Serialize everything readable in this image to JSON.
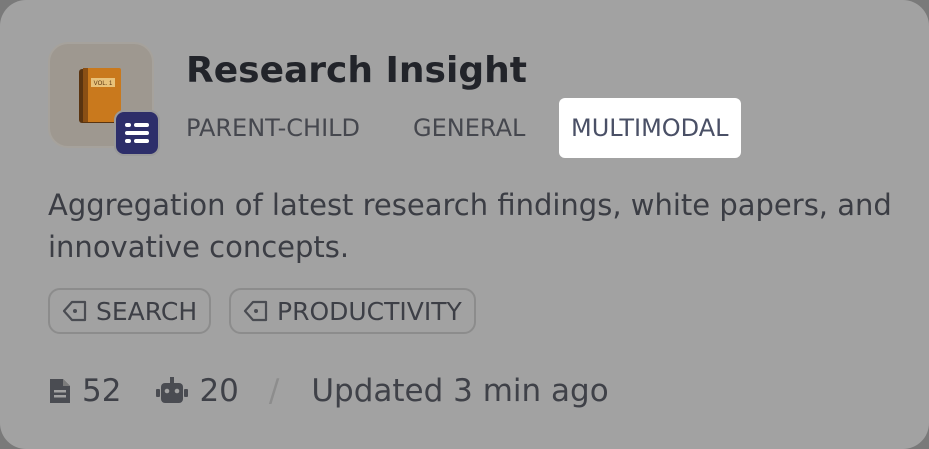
{
  "dataset": {
    "title": "Research Insight",
    "description": "Aggregation of latest research findings, white papers, and innovative concepts.",
    "book_label": "VOL. 1"
  },
  "modes": [
    "PARENT-CHILD",
    "GENERAL",
    "MULTIMODAL"
  ],
  "selected_mode": "MULTIMODAL",
  "tags": [
    "SEARCH",
    "PRODUCTIVITY"
  ],
  "stats": {
    "documents": "52",
    "apps": "20",
    "separator": "/",
    "updated": "Updated 3 min ago"
  },
  "icons": {
    "app": "book-icon",
    "badge": "list-icon",
    "tag": "tag-icon",
    "documents": "document-icon",
    "apps": "robot-icon"
  },
  "colors": {
    "badge_bg": "#2d2e6a",
    "selected_tab_bg": "#ffffff",
    "book_cover": "#d07e1c"
  }
}
